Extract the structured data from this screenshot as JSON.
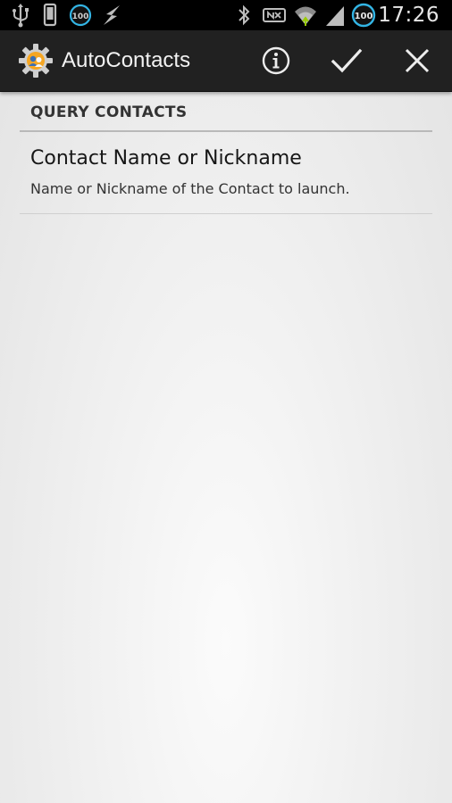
{
  "status_bar": {
    "time": "17:26",
    "left_icons": [
      "usb-icon",
      "phone-icon",
      "battery-100-icon",
      "flash-icon"
    ],
    "right_icons": [
      "bluetooth-icon",
      "nfc-icon",
      "wifi-icon",
      "signal-icon",
      "battery-100-icon"
    ],
    "battery_badge_left": "100",
    "battery_badge_right": "100"
  },
  "action_bar": {
    "title": "AutoContacts",
    "app_icon": "autocontacts-gear-icon",
    "actions": [
      "info-icon",
      "check-icon",
      "close-icon"
    ]
  },
  "section": {
    "header": "QUERY CONTACTS"
  },
  "preference": {
    "title": "Contact Name or Nickname",
    "summary": "Name or Nickname of the Contact to launch."
  },
  "colors": {
    "status_bar_bg": "#000000",
    "action_bar_bg": "#212121",
    "content_bg": "#ececec",
    "accent_blue": "#33b5e5"
  }
}
